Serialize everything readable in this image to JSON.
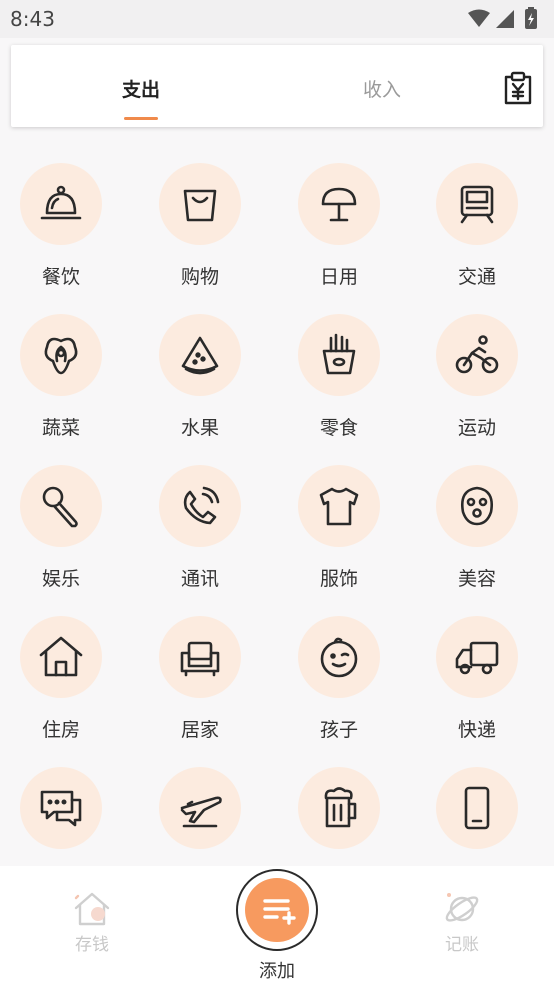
{
  "status_bar": {
    "time": "8:43"
  },
  "tabs": {
    "expense": "支出",
    "income": "收入",
    "active": "expense"
  },
  "categories": [
    {
      "label": "餐饮",
      "icon": "dining-bell-icon"
    },
    {
      "label": "购物",
      "icon": "shopping-bag-icon"
    },
    {
      "label": "日用",
      "icon": "mushroom-lamp-icon"
    },
    {
      "label": "交通",
      "icon": "train-icon"
    },
    {
      "label": "蔬菜",
      "icon": "vegetable-icon"
    },
    {
      "label": "水果",
      "icon": "watermelon-icon"
    },
    {
      "label": "零食",
      "icon": "fries-icon"
    },
    {
      "label": "运动",
      "icon": "bicycle-icon"
    },
    {
      "label": "娱乐",
      "icon": "microphone-icon"
    },
    {
      "label": "通讯",
      "icon": "phone-icon"
    },
    {
      "label": "服饰",
      "icon": "tshirt-icon"
    },
    {
      "label": "美容",
      "icon": "face-mask-icon"
    },
    {
      "label": "住房",
      "icon": "house-icon"
    },
    {
      "label": "居家",
      "icon": "sofa-icon"
    },
    {
      "label": "孩子",
      "icon": "baby-icon"
    },
    {
      "label": "快递",
      "icon": "truck-icon"
    },
    {
      "label": "",
      "icon": "chat-icon"
    },
    {
      "label": "",
      "icon": "airplane-icon"
    },
    {
      "label": "",
      "icon": "beer-icon"
    },
    {
      "label": "",
      "icon": "mobile-phone-icon"
    }
  ],
  "bottom_nav": {
    "save": "存钱",
    "add": "添加",
    "account": "记账"
  },
  "colors": {
    "accent": "#f08a4b",
    "circle_bg": "#fcebdf",
    "add_button": "#f79a5f"
  }
}
